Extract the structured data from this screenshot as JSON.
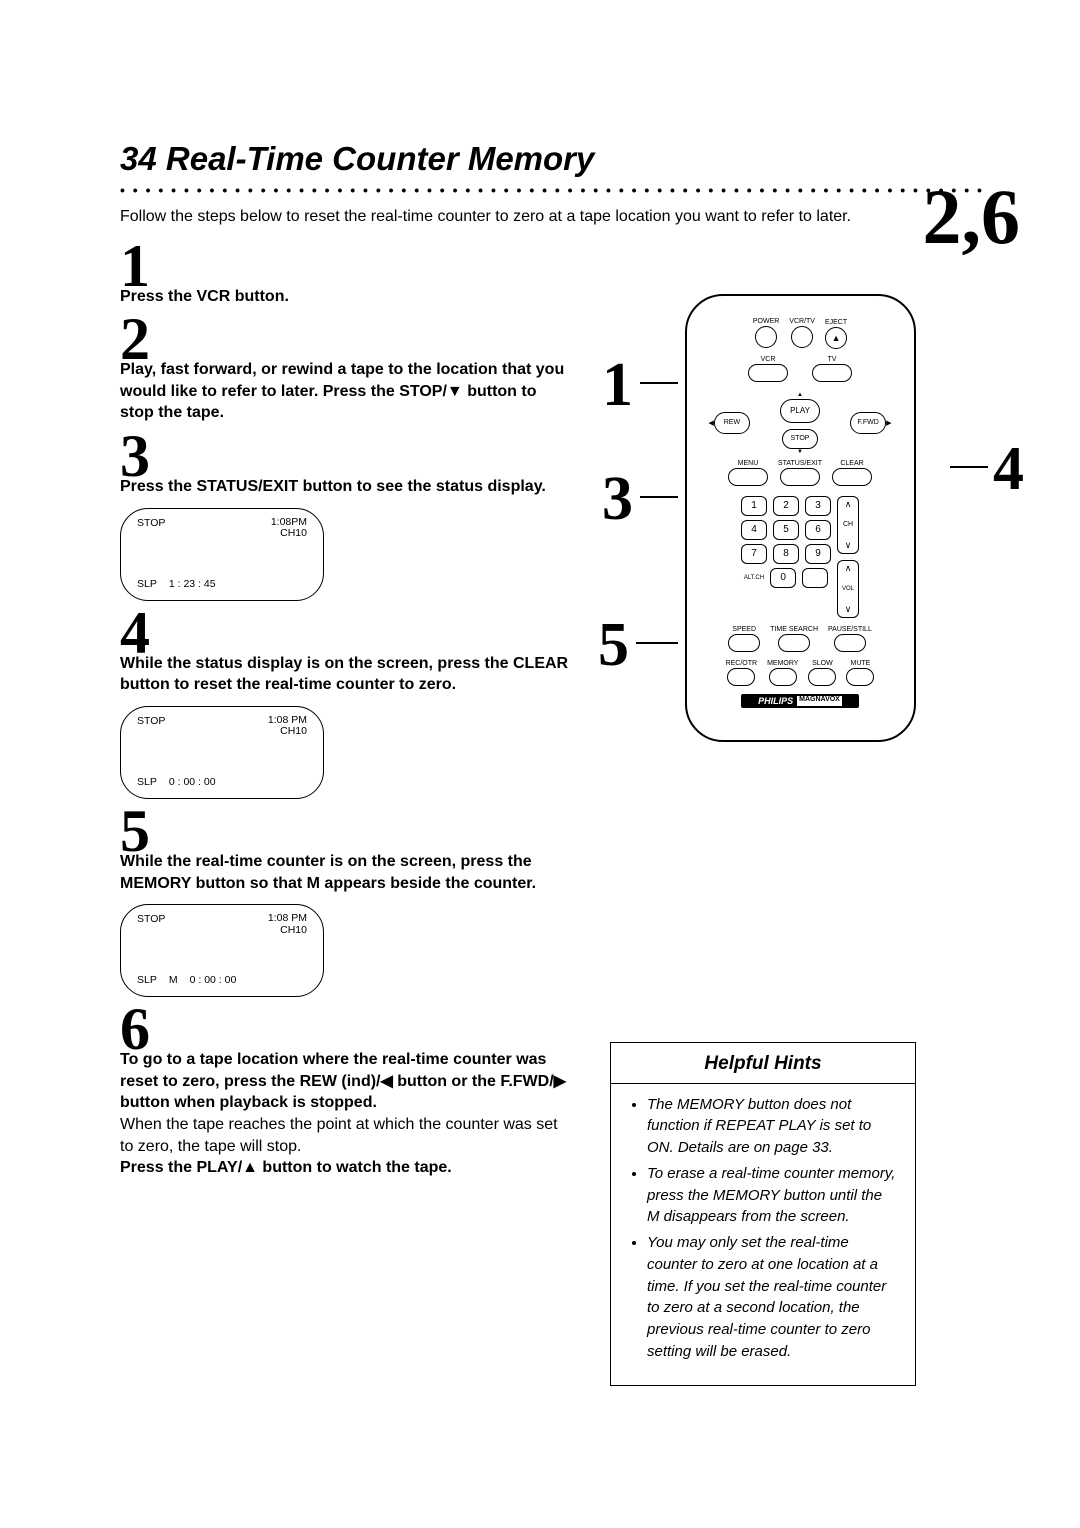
{
  "page_number": "34",
  "title": "Real-Time Counter Memory",
  "intro": "Follow the steps below to reset the real-time counter to zero at a tape location you want to refer to later.",
  "steps": {
    "s1": {
      "num": "1",
      "text": "Press the VCR button."
    },
    "s2": {
      "num": "2",
      "text": "Play, fast forward, or rewind a tape to the location that you would like to refer to later. Press the STOP/▼ button to stop the tape."
    },
    "s3": {
      "num": "3",
      "text": "Press the STATUS/EXIT button to see the status display."
    },
    "s4": {
      "num": "4",
      "text": "While the status display is on the screen, press the CLEAR button to reset the real-time counter to zero."
    },
    "s5": {
      "num": "5",
      "text": "While the real-time counter is on the screen, press the MEMORY button so that M appears beside the counter."
    },
    "s6": {
      "num": "6",
      "text_a": "To go to a tape location where the real-time counter was reset to zero, press the REW (ind)/◀ button or the F.FWD/▶ button when playback is stopped.",
      "text_b": "When the tape reaches the point at which the counter was set to zero, the tape will stop.",
      "text_c": "Press the PLAY/▲ button to watch the tape."
    }
  },
  "displays": {
    "d3": {
      "stop": "STOP",
      "time": "1:08PM",
      "ch": "CH10",
      "slp": "SLP",
      "counter": "1 : 23 : 45"
    },
    "d4": {
      "stop": "STOP",
      "time": "1:08 PM",
      "ch": "CH10",
      "slp": "SLP",
      "counter": "0 : 00 : 00"
    },
    "d5": {
      "stop": "STOP",
      "time": "1:08 PM",
      "ch": "CH10",
      "slp": "SLP",
      "m": "M",
      "counter": "0 : 00 : 00"
    }
  },
  "callouts": {
    "top_right": "2,6",
    "c1": "1",
    "c3": "3",
    "c4": "4",
    "c5": "5"
  },
  "remote": {
    "row1": {
      "power": "POWER",
      "vcrtv": "VCR/TV",
      "eject": "EJECT"
    },
    "row2": {
      "vcr": "VCR",
      "tv": "TV"
    },
    "transport": {
      "play": "PLAY",
      "rew": "REW",
      "ffwd": "F.FWD",
      "stop": "STOP"
    },
    "row_menu": {
      "menu": "MENU",
      "status": "STATUS/EXIT",
      "clear": "CLEAR"
    },
    "numbers": [
      "1",
      "2",
      "3",
      "4",
      "5",
      "6",
      "7",
      "8",
      "9",
      "0"
    ],
    "ch": "CH",
    "altch": "ALT.CH",
    "vol": "VOL",
    "row_bottom1": {
      "speed": "SPEED",
      "tsearch": "TIME SEARCH",
      "pause": "PAUSE/STILL"
    },
    "row_bottom2": {
      "recotr": "REC/OTR",
      "memory": "MEMORY",
      "slow": "SLOW",
      "mute": "MUTE"
    },
    "brand1": "PHILIPS",
    "brand2": "MAGNAVOX"
  },
  "hints": {
    "title": "Helpful Hints",
    "items": [
      "The MEMORY button does not function if REPEAT PLAY is set to ON. Details are on page 33.",
      "To erase a real-time counter memory, press the MEMORY button until the M disappears from the screen.",
      "You may only set the real-time counter to zero at one location at a time. If you set the real-time counter to zero at a second location, the previous real-time counter to zero setting will be erased."
    ]
  }
}
